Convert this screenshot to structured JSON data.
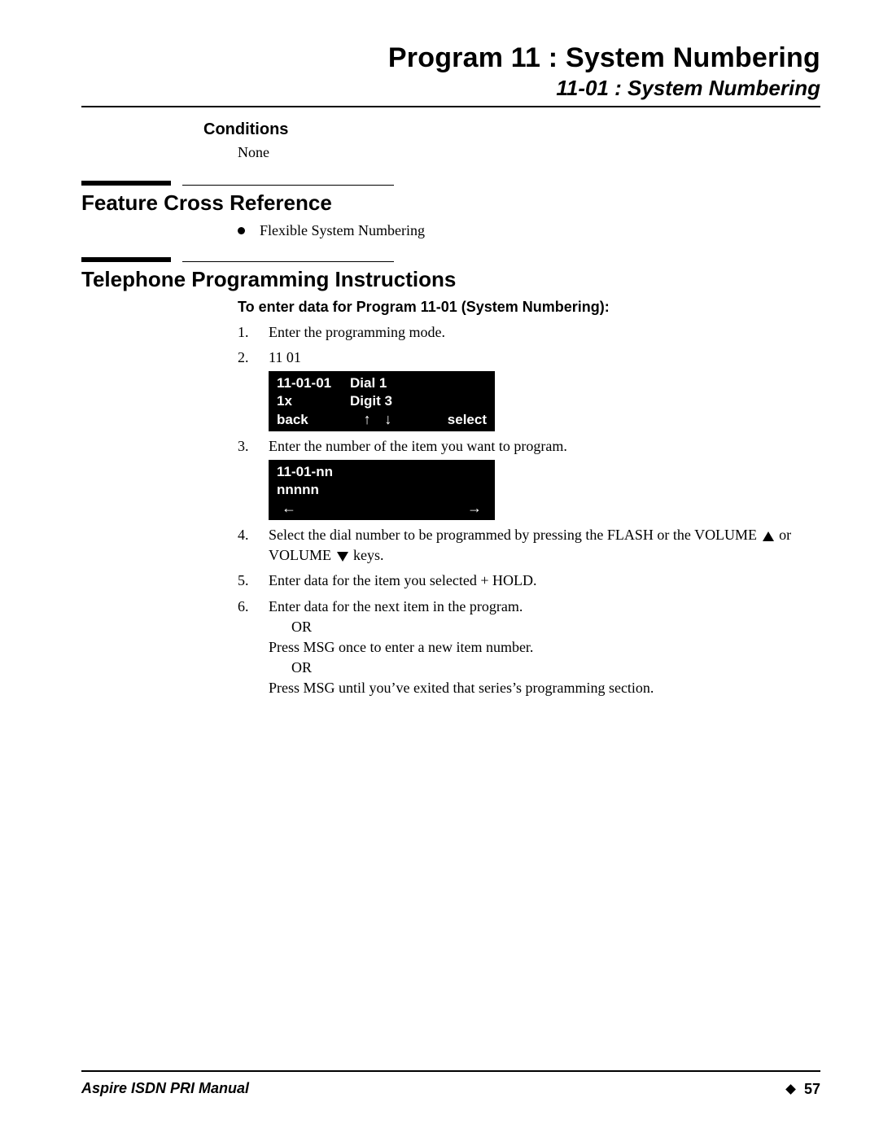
{
  "header": {
    "title": "Program 11 : System Numbering",
    "subtitle": "11-01 : System Numbering"
  },
  "conditions": {
    "heading": "Conditions",
    "value": "None"
  },
  "feature_xref": {
    "heading": "Feature Cross Reference",
    "items": [
      "Flexible System Numbering"
    ]
  },
  "instructions": {
    "heading": "Telephone Programming Instructions",
    "lead": "To enter data for Program 11-01 (System Numbering):",
    "steps": {
      "s1": "Enter the programming mode.",
      "s2": "11 01",
      "s3": "Enter the number of the item you want to program.",
      "s4_a": "Select the dial number to be programmed by pressing the FLASH or the VOLUME ",
      "s4_b": " or VOLUME ",
      "s4_c": " keys.",
      "s5": "Enter data for the item you selected + HOLD.",
      "s6_a": "Enter data for the next item in the program.",
      "s6_or": "OR",
      "s6_b": "Press MSG once to enter a new item number.",
      "s6_c": "Press MSG until you’ve exited that series’s programming section."
    }
  },
  "lcd1": {
    "r1c1": "11-01-01",
    "r1c2": "Dial  1",
    "r2c1": "1x",
    "r2c2": "Digit 3",
    "back": "back",
    "select": "select"
  },
  "lcd2": {
    "r1": "11-01-nn",
    "r2": "nnnnn"
  },
  "footer": {
    "manual": "Aspire ISDN PRI Manual",
    "page": "57"
  }
}
